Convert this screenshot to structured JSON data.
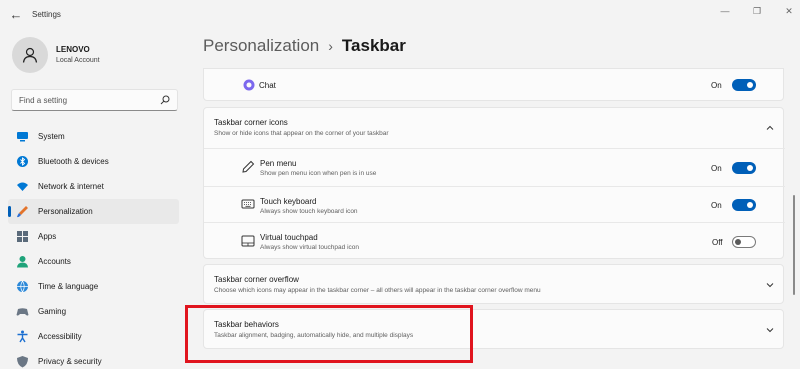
{
  "window": {
    "title": "Settings",
    "back_glyph": "←",
    "minimize_glyph": "—",
    "maximize_glyph": "❐",
    "close_glyph": "✕"
  },
  "profile": {
    "name": "LENOVO",
    "account_type": "Local Account"
  },
  "search": {
    "placeholder": "Find a setting"
  },
  "nav": {
    "items": [
      {
        "label": "System",
        "icon": "system-icon"
      },
      {
        "label": "Bluetooth & devices",
        "icon": "bluetooth-icon"
      },
      {
        "label": "Network & internet",
        "icon": "wifi-icon"
      },
      {
        "label": "Personalization",
        "icon": "brush-icon",
        "active": true
      },
      {
        "label": "Apps",
        "icon": "apps-icon"
      },
      {
        "label": "Accounts",
        "icon": "accounts-icon"
      },
      {
        "label": "Time & language",
        "icon": "globe-icon"
      },
      {
        "label": "Gaming",
        "icon": "gaming-icon"
      },
      {
        "label": "Accessibility",
        "icon": "accessibility-icon"
      },
      {
        "label": "Privacy & security",
        "icon": "shield-icon"
      }
    ]
  },
  "breadcrumb": {
    "parent": "Personalization",
    "separator": "›",
    "current": "Taskbar"
  },
  "chat": {
    "label": "Chat",
    "state": "On",
    "on": true
  },
  "corner_icons": {
    "title": "Taskbar corner icons",
    "subtitle": "Show or hide icons that appear on the corner of your taskbar",
    "expanded": true,
    "items": [
      {
        "title": "Pen menu",
        "subtitle": "Show pen menu icon when pen is in use",
        "state": "On",
        "on": true,
        "icon": "pen-icon"
      },
      {
        "title": "Touch keyboard",
        "subtitle": "Always show touch keyboard icon",
        "state": "On",
        "on": true,
        "icon": "keyboard-icon"
      },
      {
        "title": "Virtual touchpad",
        "subtitle": "Always show virtual touchpad icon",
        "state": "Off",
        "on": false,
        "icon": "touchpad-icon"
      }
    ]
  },
  "corner_overflow": {
    "title": "Taskbar corner overflow",
    "subtitle": "Choose which icons may appear in the taskbar corner – all others will appear in the taskbar corner overflow menu"
  },
  "behaviors": {
    "title": "Taskbar behaviors",
    "subtitle": "Taskbar alignment, badging, automatically hide, and multiple displays"
  },
  "colors": {
    "accent": "#005fb8",
    "highlight": "#e0141e"
  }
}
